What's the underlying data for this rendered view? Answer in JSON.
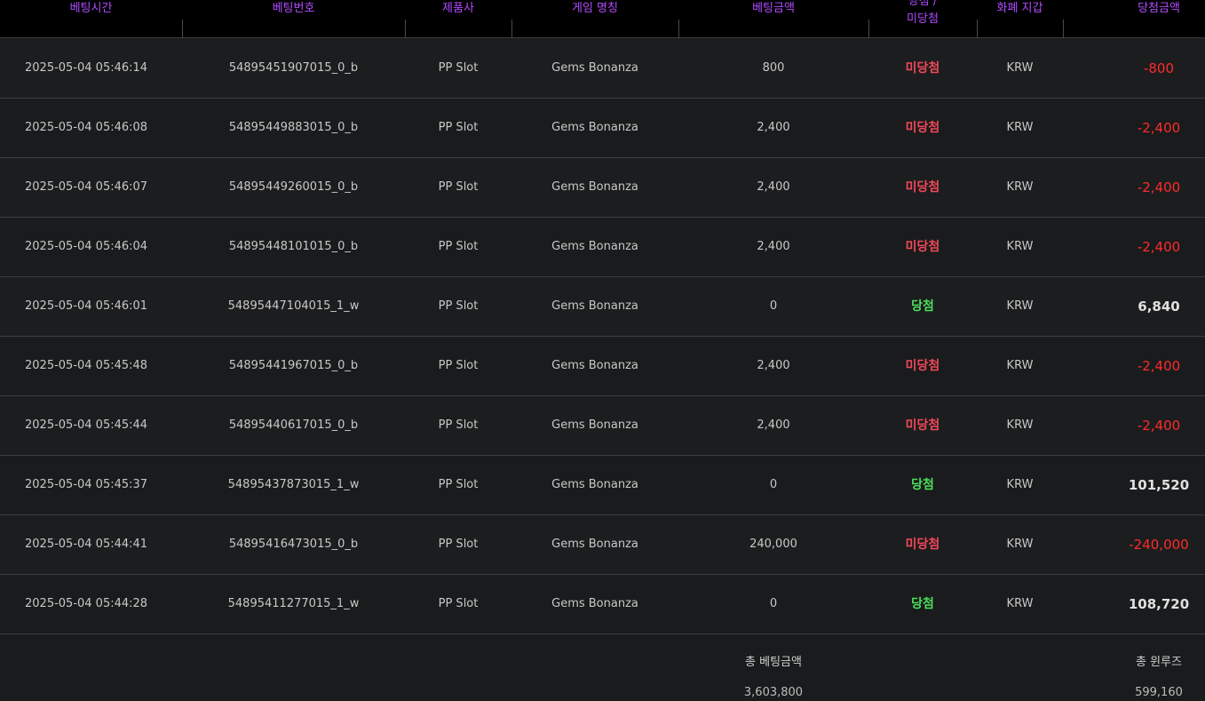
{
  "headers": {
    "bet_time": "베팅시간",
    "bet_id": "베팅번호",
    "provider": "제품사",
    "game_name": "게임 명칭",
    "bet_amount": "베팅금액",
    "result_line1": "당첨 /",
    "result_line2": "미당첨",
    "currency_wallet": "화폐 지갑",
    "win_amount": "당첨금액"
  },
  "rows": [
    {
      "time": "2025-05-04 05:46:14",
      "id": "54895451907015_0_b",
      "provider": "PP Slot",
      "game": "Gems Bonanza",
      "bet": "800",
      "result": "미당첨",
      "currency": "KRW",
      "win": "-800"
    },
    {
      "time": "2025-05-04 05:46:08",
      "id": "54895449883015_0_b",
      "provider": "PP Slot",
      "game": "Gems Bonanza",
      "bet": "2,400",
      "result": "미당첨",
      "currency": "KRW",
      "win": "-2,400"
    },
    {
      "time": "2025-05-04 05:46:07",
      "id": "54895449260015_0_b",
      "provider": "PP Slot",
      "game": "Gems Bonanza",
      "bet": "2,400",
      "result": "미당첨",
      "currency": "KRW",
      "win": "-2,400"
    },
    {
      "time": "2025-05-04 05:46:04",
      "id": "54895448101015_0_b",
      "provider": "PP Slot",
      "game": "Gems Bonanza",
      "bet": "2,400",
      "result": "미당첨",
      "currency": "KRW",
      "win": "-2,400"
    },
    {
      "time": "2025-05-04 05:46:01",
      "id": "54895447104015_1_w",
      "provider": "PP Slot",
      "game": "Gems Bonanza",
      "bet": "0",
      "result": "당첨",
      "currency": "KRW",
      "win": "6,840"
    },
    {
      "time": "2025-05-04 05:45:48",
      "id": "54895441967015_0_b",
      "provider": "PP Slot",
      "game": "Gems Bonanza",
      "bet": "2,400",
      "result": "미당첨",
      "currency": "KRW",
      "win": "-2,400"
    },
    {
      "time": "2025-05-04 05:45:44",
      "id": "54895440617015_0_b",
      "provider": "PP Slot",
      "game": "Gems Bonanza",
      "bet": "2,400",
      "result": "미당첨",
      "currency": "KRW",
      "win": "-2,400"
    },
    {
      "time": "2025-05-04 05:45:37",
      "id": "54895437873015_1_w",
      "provider": "PP Slot",
      "game": "Gems Bonanza",
      "bet": "0",
      "result": "당첨",
      "currency": "KRW",
      "win": "101,520"
    },
    {
      "time": "2025-05-04 05:44:41",
      "id": "54895416473015_0_b",
      "provider": "PP Slot",
      "game": "Gems Bonanza",
      "bet": "240,000",
      "result": "미당첨",
      "currency": "KRW",
      "win": "-240,000"
    },
    {
      "time": "2025-05-04 05:44:28",
      "id": "54895411277015_1_w",
      "provider": "PP Slot",
      "game": "Gems Bonanza",
      "bet": "0",
      "result": "당첨",
      "currency": "KRW",
      "win": "108,720"
    }
  ],
  "footer": {
    "total_bet_label": "총 베팅금액",
    "total_bet_value": "3,603,800",
    "total_winloss_label": "총 윈루즈",
    "total_winloss_value": "599,160"
  },
  "colors": {
    "header_text": "#b04cff",
    "lose": "#f0485a",
    "win": "#4dde5a",
    "negative_amount": "#ff2b2b"
  }
}
